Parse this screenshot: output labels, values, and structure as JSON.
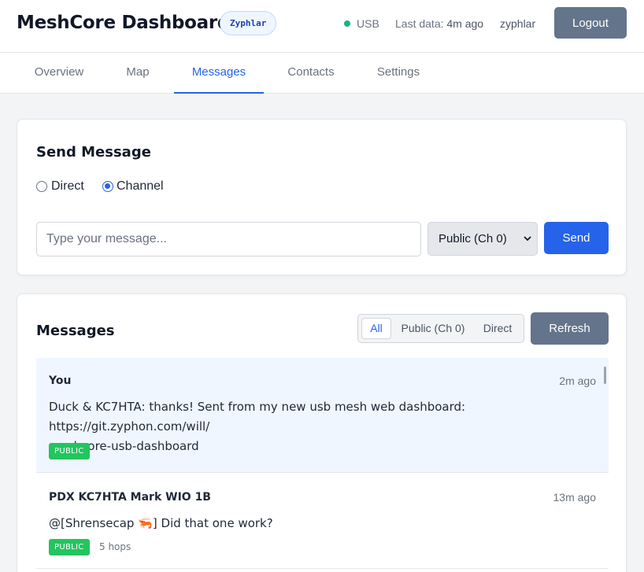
{
  "header": {
    "title": "MeshCore Dashboard",
    "node_badge": "Zyphlar",
    "connection": "USB",
    "last_data_label": "Last data:",
    "last_data_value": "4m ago",
    "user": "zyphlar",
    "logout_label": "Logout",
    "status_color": "#10b981"
  },
  "nav": {
    "tabs": [
      {
        "label": "Overview"
      },
      {
        "label": "Map"
      },
      {
        "label": "Messages",
        "active": true
      },
      {
        "label": "Contacts"
      },
      {
        "label": "Settings"
      }
    ]
  },
  "send": {
    "title": "Send Message",
    "mode_options": [
      "Direct",
      "Channel"
    ],
    "selected_mode": "Channel",
    "input_placeholder": "Type your message...",
    "input_value": "",
    "channel_selected": "Public (Ch 0)",
    "send_label": "Send"
  },
  "messages": {
    "title": "Messages",
    "filters": [
      "All",
      "Public (Ch 0)",
      "Direct"
    ],
    "active_filter": "All",
    "refresh_label": "Refresh",
    "items": [
      {
        "sender": "You",
        "time": "2m ago",
        "text_line1": "Duck & KC7HTA: thanks! Sent from my new usb mesh web dashboard: https://git.zyphon.com/will/",
        "text_line2": "meshcore-usb-dashboard",
        "tag": "PUBLIC",
        "hops": ""
      },
      {
        "sender": "PDX KC7HTA Mark WIO 1B",
        "time": "13m ago",
        "text_line1": "@[Shrensecap 🦐] Did that one work?",
        "text_line2": "",
        "tag": "PUBLIC",
        "hops": "5 hops"
      }
    ]
  },
  "colors": {
    "accent": "#2563eb",
    "secondary_button": "#64748b",
    "public_tag": "#22c55e",
    "own_message_bg": "#eff6ff"
  }
}
